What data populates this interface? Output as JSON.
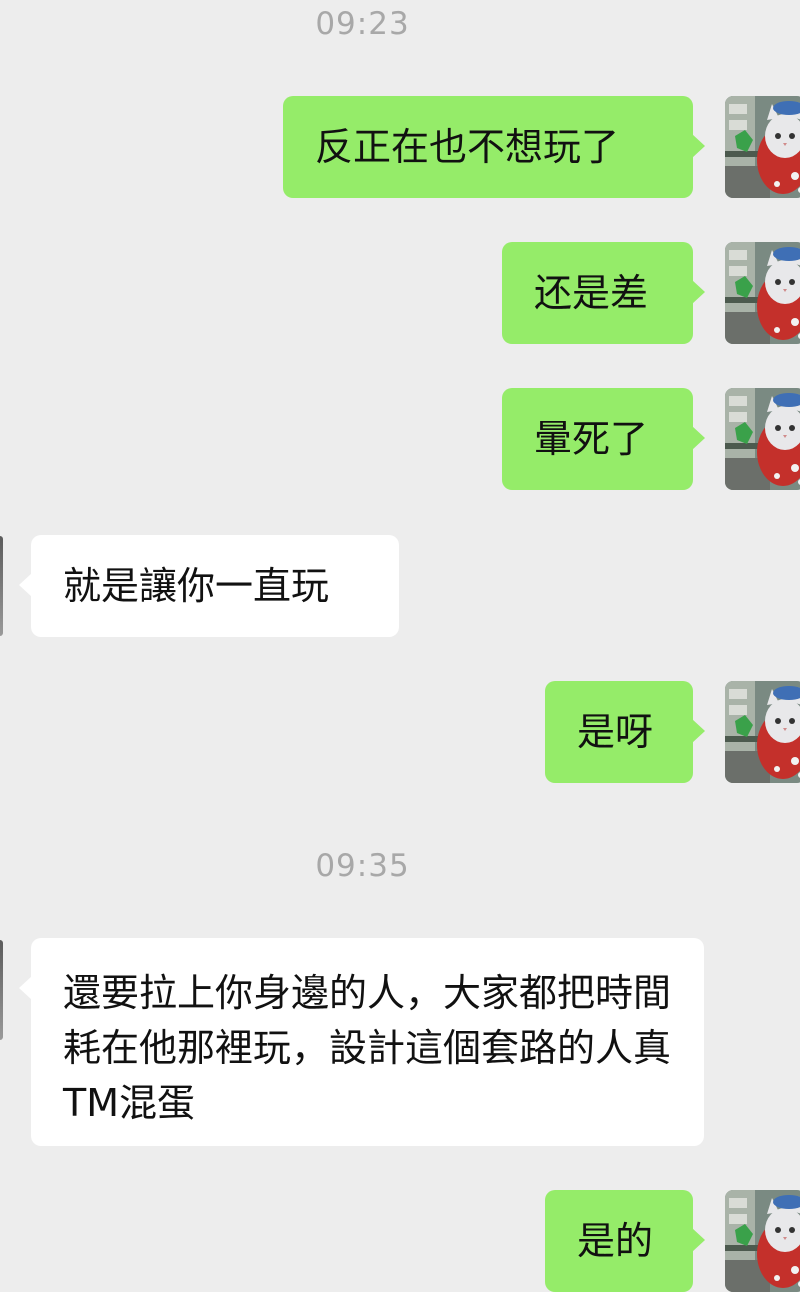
{
  "chat": {
    "timestamps": [
      "09:23",
      "09:35"
    ],
    "messages": [
      {
        "sender": "me",
        "text": "反正在也不想玩了"
      },
      {
        "sender": "me",
        "text": "还是差"
      },
      {
        "sender": "me",
        "text": "暈死了"
      },
      {
        "sender": "them",
        "text": "就是讓你一直玩"
      },
      {
        "sender": "me",
        "text": "是呀"
      },
      {
        "sender": "them",
        "text": "還要拉上你身邊的人，大家都把時間耗在他那裡玩，設計這個套路的人真 TM混蛋"
      },
      {
        "sender": "me",
        "text": "是的"
      }
    ]
  },
  "colors": {
    "background": "#ededed",
    "outgoing_bubble": "#95ec69",
    "incoming_bubble": "#ffffff",
    "timestamp": "#a8a8a8"
  },
  "icons": {
    "my_avatar": "cat-avatar-icon",
    "their_avatar": "contact-avatar-icon"
  }
}
